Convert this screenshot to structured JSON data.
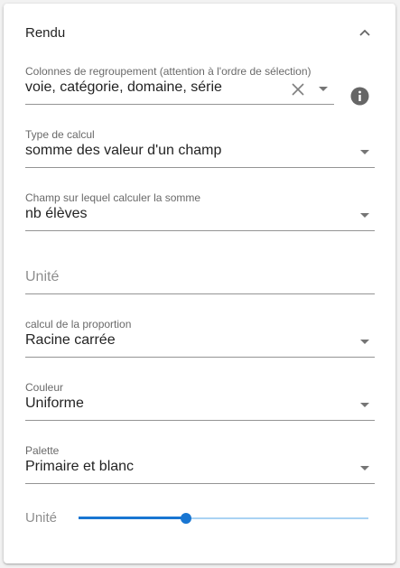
{
  "section": {
    "title": "Rendu"
  },
  "fields": {
    "grouping": {
      "label": "Colonnes de regroupement (attention à l'ordre de sélection)",
      "value": "voie,  catégorie,  domaine,  série"
    },
    "calc_type": {
      "label": "Type de calcul",
      "value": "somme des valeur d'un champ"
    },
    "sum_field": {
      "label": "Champ sur lequel calculer la somme",
      "value": "nb élèves"
    },
    "unit": {
      "placeholder": "Unité"
    },
    "proportion": {
      "label": "calcul de la proportion",
      "value": "Racine carrée"
    },
    "color": {
      "label": "Couleur",
      "value": "Uniforme"
    },
    "palette": {
      "label": "Palette",
      "value": "Primaire et blanc"
    }
  },
  "slider": {
    "label": "Unité",
    "value_fraction": 0.37
  },
  "colors": {
    "accent": "#1976d2",
    "rail": "#a9d3f3",
    "icon": "#666666"
  }
}
